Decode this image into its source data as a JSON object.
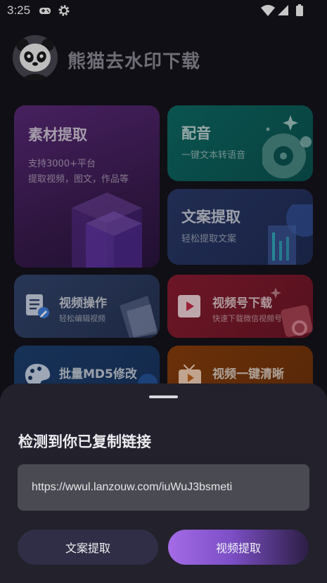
{
  "status_bar": {
    "time": "3:25",
    "icons": [
      "gamepad-icon",
      "gear-icon",
      "wifi-icon",
      "signal-icon",
      "battery-icon"
    ]
  },
  "header": {
    "app_title": "熊猫去水印下载",
    "avatar": "panda-avatar"
  },
  "cards": {
    "material": {
      "title": "素材提取",
      "subtitle_line1": "支持3000+平台",
      "subtitle_line2": "提取视频，图文，作品等"
    },
    "dub": {
      "title": "配音",
      "subtitle": "一键文本转语音"
    },
    "copy": {
      "title": "文案提取",
      "subtitle": "轻松提取文案"
    },
    "video_edit": {
      "title": "视频操作",
      "subtitle": "轻松编辑视频"
    },
    "channel_download": {
      "title": "视频号下载",
      "subtitle": "快速下载微信视频号"
    },
    "md5": {
      "title": "批量MD5修改"
    },
    "hd": {
      "title": "视频一键清晰"
    }
  },
  "sheet": {
    "title": "检测到你已复制链接",
    "link": "https://wwul.lanzouw.com/iuWuJ3bsmeti",
    "btn_copy_label": "文案提取",
    "btn_video_label": "视频提取"
  },
  "colors": {
    "background": "#15141c",
    "sheet": "#22212c",
    "accent_purple": "#a46be6"
  }
}
